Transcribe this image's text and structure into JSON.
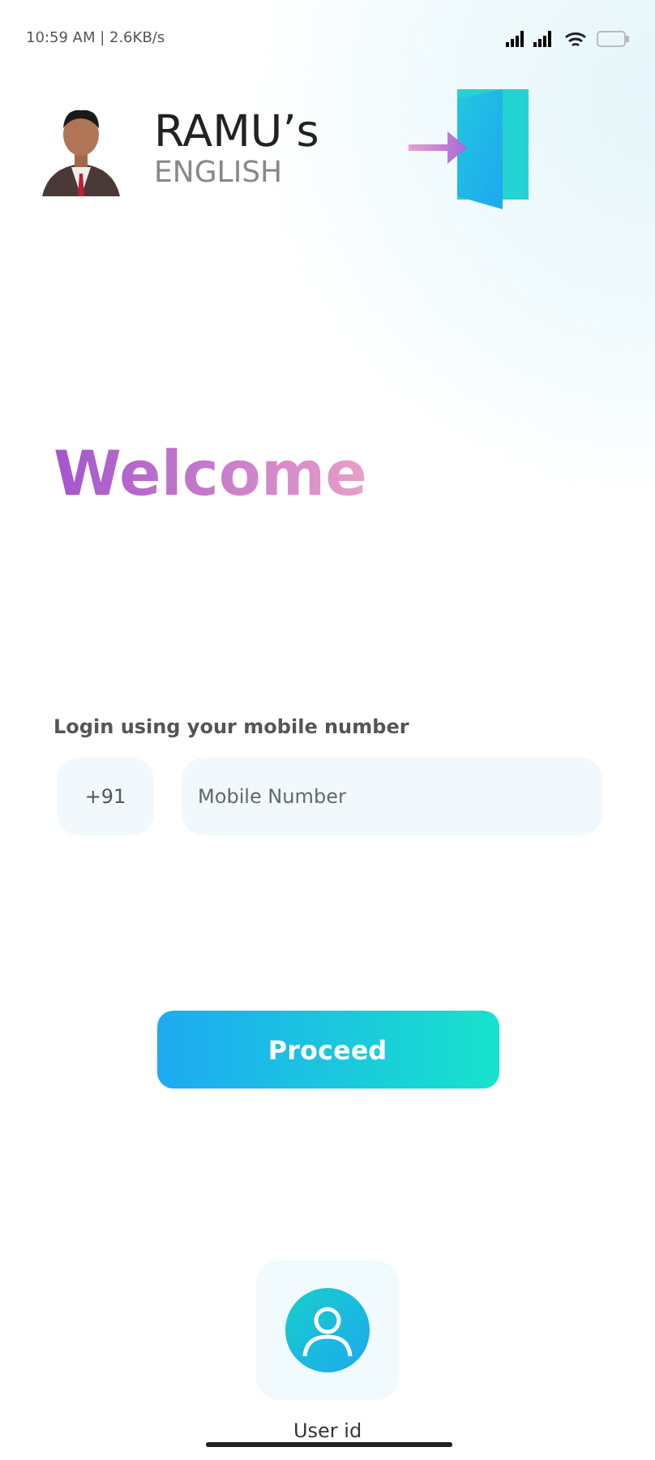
{
  "status_bar": {
    "time": "10:59 AM | 2.6KB/s"
  },
  "header": {
    "brand_title": "RAMU’s",
    "brand_subtitle": "ENGLISH"
  },
  "welcome": "Welcome",
  "login": {
    "label": "Login using your mobile number",
    "country_code": "+91",
    "phone_placeholder": "Mobile Number"
  },
  "proceed_button": "Proceed",
  "alt_login": {
    "label": "User id"
  }
}
